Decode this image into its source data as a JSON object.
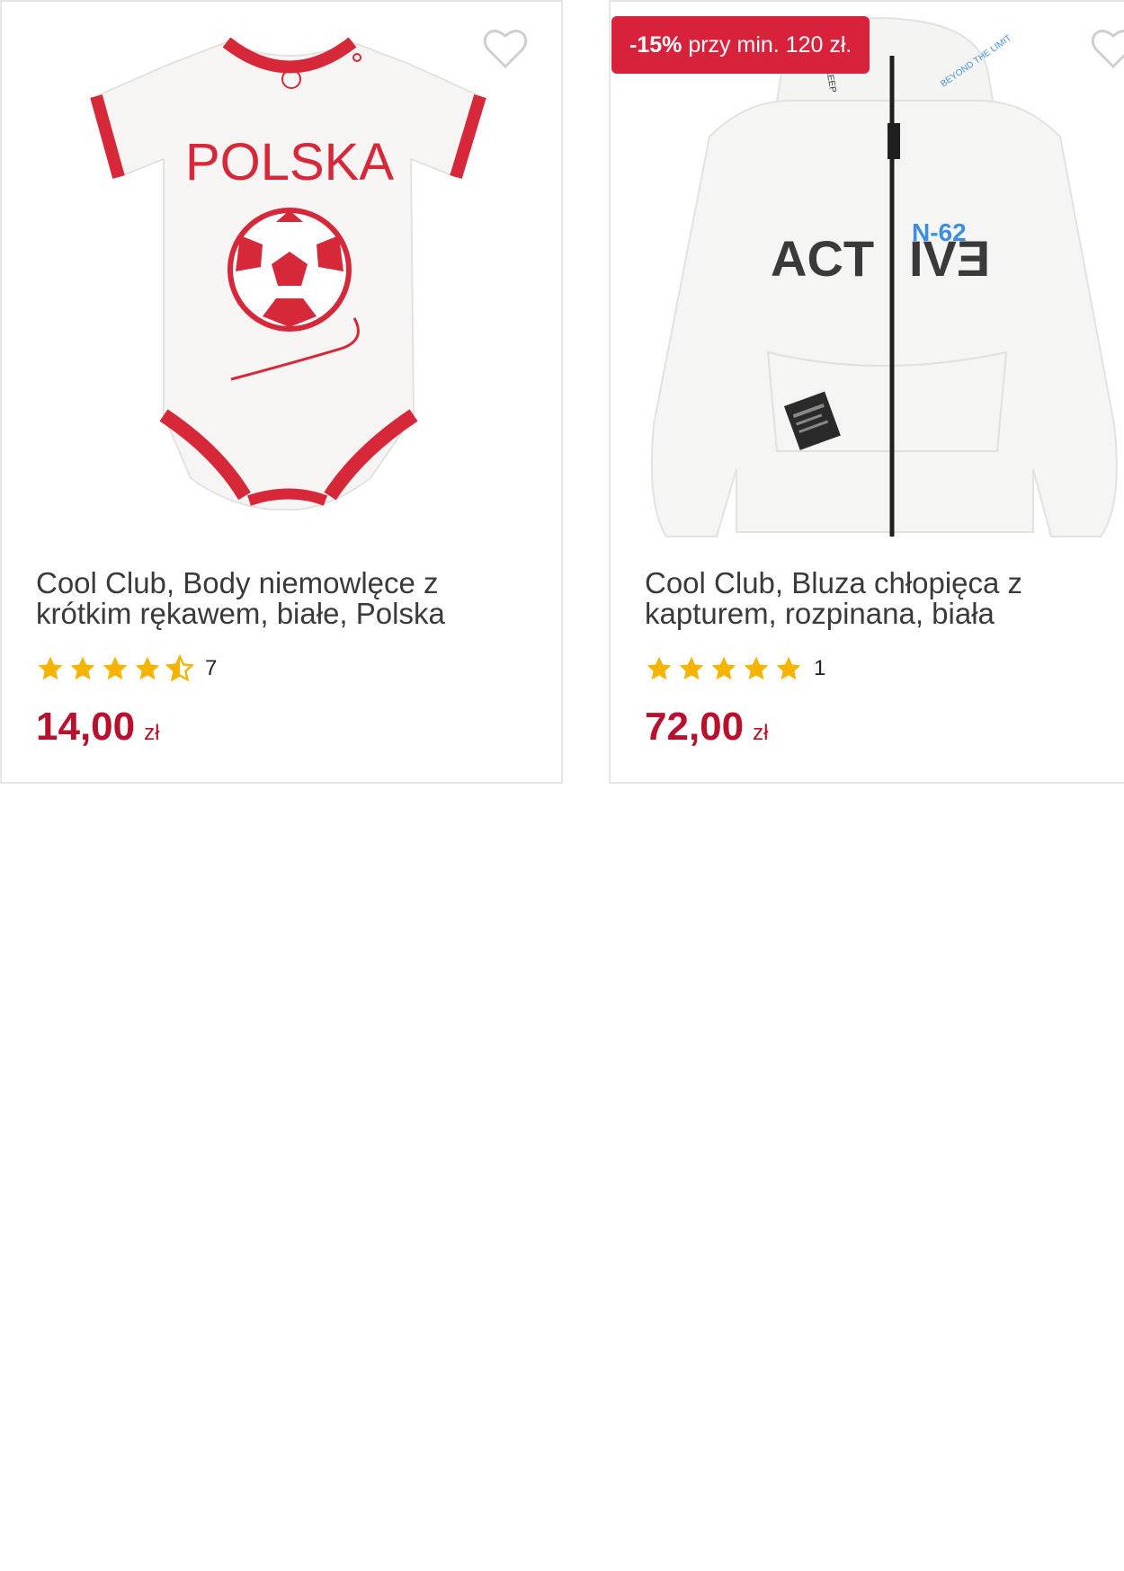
{
  "products": [
    {
      "name": "Cool Club, Body niemowlęce z krótkim rękawem, białe, Polska",
      "image_print": "POLSKA",
      "rating": 4.5,
      "rating_count": "7",
      "price": "14,00",
      "currency": "zł",
      "wishlist_icon": "heart-outline-icon"
    },
    {
      "name": "Cool Club, Bluza chłopięca z kapturem, rozpinana, biała",
      "promo_badge": {
        "discount": "-15%",
        "text": "przy min. 120 zł."
      },
      "image_print": {
        "left": "ACT",
        "right": "IVƎ",
        "tag": "N-62"
      },
      "rating": 5,
      "rating_count": "1",
      "price": "72,00",
      "currency": "zł",
      "wishlist_icon": "heart-outline-icon"
    }
  ],
  "colors": {
    "price": "#b8102d",
    "promo_bg": "#d8213b",
    "star": "#f5b400",
    "accent_red": "#d62839"
  }
}
